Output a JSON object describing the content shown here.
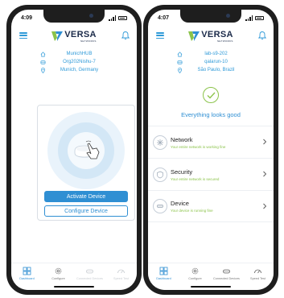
{
  "left": {
    "time": "4:09",
    "brand": {
      "name": "VERSA",
      "sub": "NETWORKS"
    },
    "info": {
      "device": "MunichHUB",
      "serial": "Org202Nishu-7",
      "location": "Munich, Germany"
    },
    "card": {
      "activate_label": "Activate Device",
      "configure_label": "Configure Device"
    },
    "nav": [
      {
        "label": "Dashboard"
      },
      {
        "label": "Configure"
      },
      {
        "label": "Connected Devices"
      },
      {
        "label": "Speed Test"
      }
    ]
  },
  "right": {
    "time": "4:07",
    "brand": {
      "name": "VERSA",
      "sub": "NETWORKS"
    },
    "info": {
      "device": "lab-s9-202",
      "serial": "qalarun-10",
      "location": "São Paulo, Brazil"
    },
    "status_message": "Everything looks good",
    "items": [
      {
        "title": "Network",
        "subtitle": "Your entire network is working fine"
      },
      {
        "title": "Security",
        "subtitle": "Your entire network is secured"
      },
      {
        "title": "Device",
        "subtitle": "Your device is running fine"
      }
    ],
    "nav": [
      {
        "label": "Dashboard"
      },
      {
        "label": "Configure"
      },
      {
        "label": "Connected Devices"
      },
      {
        "label": "Speed Test"
      }
    ]
  },
  "colors": {
    "accent": "#2f8fd3",
    "ok": "#8bc34a",
    "logo_green": "#8bc34a",
    "logo_blue": "#2f8fd3"
  }
}
